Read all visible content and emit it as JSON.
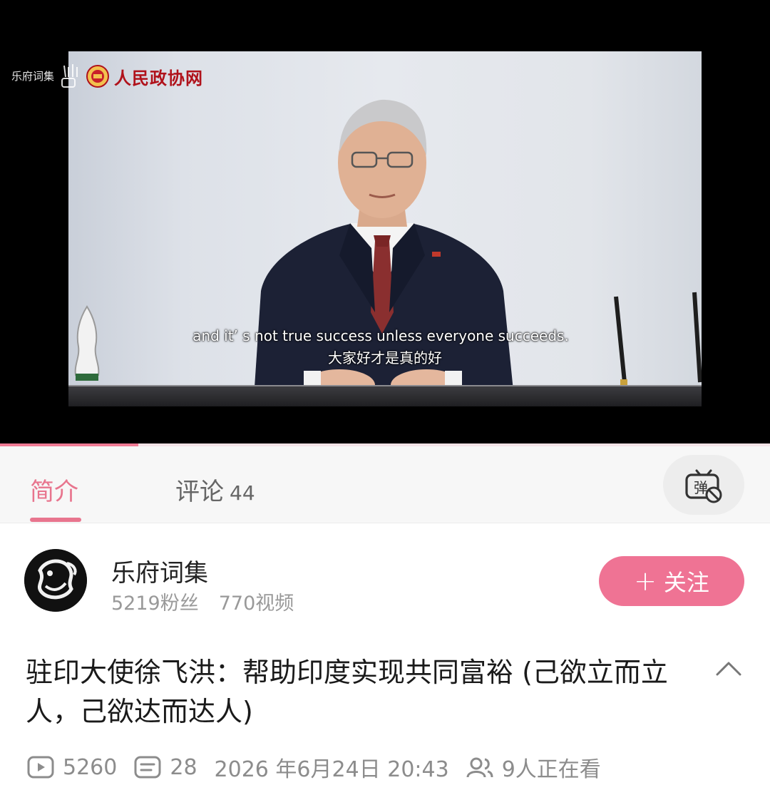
{
  "player": {
    "watermark_channel": "乐府词集",
    "logo_text": "人民政协网",
    "subtitle_en": "and it’ s not true success unless everyone succeeds.",
    "subtitle_zh": "大家好才是真的好",
    "progress": 0.18
  },
  "tabs": {
    "intro_label": "简介",
    "comments_label": "评论",
    "comments_count": "44",
    "danmaku_icon_glyph": "弹"
  },
  "uploader": {
    "name": "乐府词集",
    "followers": "5219粉丝",
    "videos": "770视频",
    "follow_label": "关注",
    "follow_plus": "+"
  },
  "video": {
    "title": "驻印大使徐飞洪：帮助印度实现共同富裕 (己欲立而立人，己欲达而达人)",
    "plays": "5260",
    "danmaku_count": "28",
    "datetime": "2026 年6月24日 20:43",
    "watching": "9人正在看"
  },
  "colors": {
    "accent": "#ef7394",
    "tab_active": "#e8758e",
    "muted": "#8c8c8c"
  },
  "icons": [
    "play-count-icon",
    "danmaku-count-icon",
    "watching-icon",
    "danmaku-toggle-icon",
    "collapse-chevron-icon"
  ]
}
